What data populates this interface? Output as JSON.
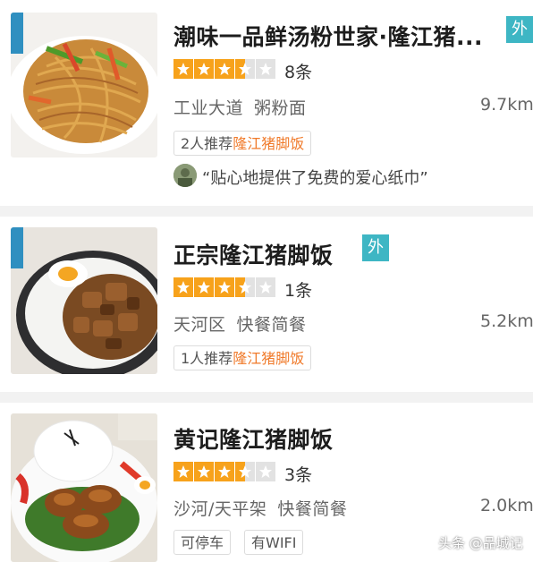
{
  "listings": [
    {
      "name": "潮味一品鲜汤粉世家·隆江猪...",
      "badge": "外",
      "rating_stars": 3.5,
      "review_count": "8条",
      "area": "工业大道",
      "category": "粥粉面",
      "distance": "9.7km",
      "tags": [
        {
          "prefix": "2人推荐",
          "highlight": "隆江猪脚饭"
        }
      ],
      "review": "“贴心地提供了免费的爱心纸巾”",
      "image": "fried-noodles-photo"
    },
    {
      "name": "正宗隆江猪脚饭",
      "badge": "外",
      "rating_stars": 3.5,
      "review_count": "1条",
      "area": "天河区",
      "category": "快餐简餐",
      "distance": "5.2km",
      "tags": [
        {
          "prefix": "1人推荐",
          "highlight": "隆江猪脚饭"
        }
      ],
      "image": "pork-rice-bowl-photo"
    },
    {
      "name": "黄记隆江猪脚饭",
      "rating_stars": 3.5,
      "review_count": "3条",
      "area": "沙河/天平架",
      "category": "快餐简餐",
      "distance": "2.0km",
      "tags": [
        {
          "label": "可停车"
        },
        {
          "label": "有WIFI"
        }
      ],
      "image": "pork-trotter-plate-photo"
    }
  ],
  "watermark": "头条 @品城记",
  "colors": {
    "star": "#f7a21b",
    "badge": "#3eb6c4",
    "highlight": "#f07a2a",
    "divider": "#f2f2f2"
  }
}
